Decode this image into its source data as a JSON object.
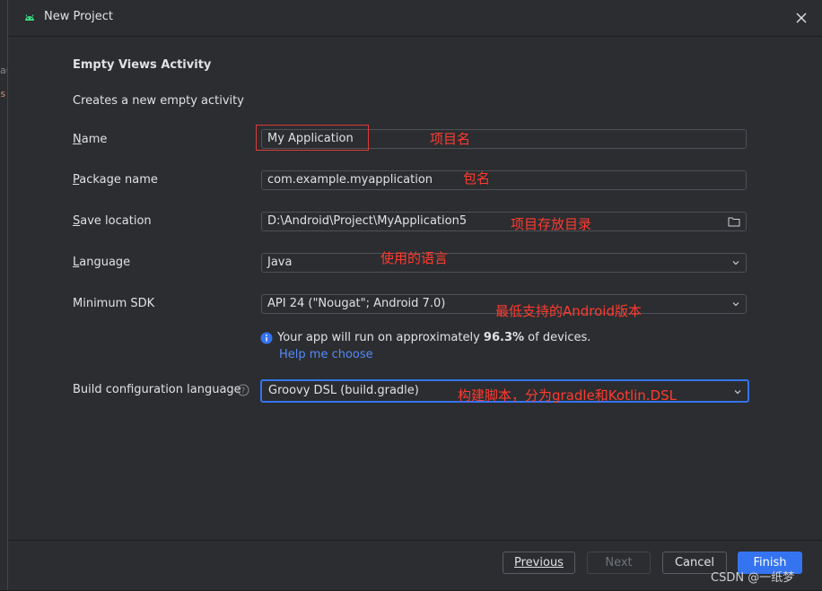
{
  "background": {
    "code_lines": [
      "au",
      "s|"
    ]
  },
  "window": {
    "title": "New Project"
  },
  "template": {
    "name": "Empty Views Activity",
    "description": "Creates a new empty activity"
  },
  "form": {
    "name": {
      "label": "Name",
      "value": "My Application"
    },
    "package": {
      "label": "Package name",
      "value": "com.example.myapplication"
    },
    "save_location": {
      "label": "Save location",
      "value": "D:\\Android\\Project\\MyApplication5"
    },
    "language": {
      "label": "Language",
      "value": "Java"
    },
    "min_sdk": {
      "label": "Minimum SDK",
      "value": "API 24 (\"Nougat\"; Android 7.0)"
    },
    "build_config": {
      "label": "Build configuration language",
      "value": "Groovy DSL (build.gradle)"
    }
  },
  "info": {
    "prefix": "Your app will run on approximately ",
    "percent": "96.3%",
    "suffix": " of devices.",
    "help_link": "Help me choose"
  },
  "annotations": {
    "name": "项目名",
    "package": "包名",
    "save_location": "项目存放目录",
    "language": "使用的语言",
    "min_sdk": "最低支持的Android版本",
    "build_config": "构建脚本，分为gradle和Kotlin.DSL"
  },
  "buttons": {
    "previous": "Previous",
    "next": "Next",
    "cancel": "Cancel",
    "finish": "Finish"
  },
  "watermark": "CSDN @一纸梦",
  "colors": {
    "accent": "#3574f0",
    "annotation": "#ff3b30",
    "link": "#548af7",
    "android": "#3ddc84"
  }
}
